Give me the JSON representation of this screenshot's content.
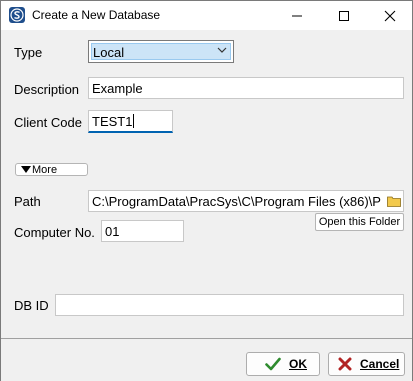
{
  "window": {
    "title": "Create a New Database",
    "icon": "app-logo-icon"
  },
  "form": {
    "type_label": "Type",
    "type_value": "Local",
    "description_label": "Description",
    "description_value": "Example",
    "client_code_label": "Client Code",
    "client_code_value": "TEST1",
    "more_label": "More",
    "path_label": "Path",
    "path_value": "C:\\ProgramData\\PracSys\\C\\Program Files (x86)\\P",
    "open_folder_label": "Open this Folder",
    "computer_no_label": "Computer No.",
    "computer_no_value": "01",
    "db_id_label": "DB ID",
    "db_id_value": ""
  },
  "buttons": {
    "ok_label": "OK",
    "cancel_label": "Cancel"
  },
  "colors": {
    "focus_accent": "#0063b1",
    "ok_check": "#2e8b2e",
    "cancel_x": "#b22222",
    "combo_highlight": "#cce4f7"
  }
}
